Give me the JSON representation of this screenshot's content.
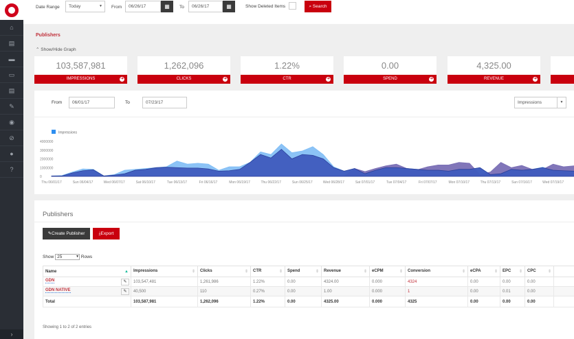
{
  "sidebar": {
    "items": [
      "home-icon",
      "file-icon",
      "folder-icon",
      "card-icon",
      "list-icon",
      "pencil-icon",
      "circle-icon",
      "ban-icon",
      "user-icon",
      "question-icon"
    ],
    "glyphs": [
      "⌂",
      "▤",
      "▬",
      "▭",
      "▤",
      "✎",
      "◉",
      "⊘",
      "●",
      "?"
    ],
    "expand": "›"
  },
  "topbar": {
    "date_range_label": "Date Range",
    "date_range_value": "Today",
    "from_label": "From",
    "from_value": "06/26/17",
    "to_label": "To",
    "to_value": "06/26/17",
    "show_deleted_label": "Show Deleted Items",
    "search_label": "Search"
  },
  "page": {
    "title": "Publishers",
    "toggle_label": "Show/Hide Graph"
  },
  "kpis": [
    {
      "value": "103,587,981",
      "label": "IMPRESSIONS"
    },
    {
      "value": "1,262,096",
      "label": "CLICKS"
    },
    {
      "value": "1.22%",
      "label": "CTR"
    },
    {
      "value": "0.00",
      "label": "SPEND"
    },
    {
      "value": "4,325.00",
      "label": "REVENUE"
    },
    {
      "value": "",
      "label": ""
    }
  ],
  "chart_filter": {
    "from_label": "From",
    "from_value": "06/01/17",
    "to_label": "To",
    "to_value": "07/23/17",
    "metric": "Impressions"
  },
  "chart_data": {
    "type": "area",
    "legend": [
      "Impressions"
    ],
    "legend_position": "top-left",
    "ylim": [
      0,
      4000000
    ],
    "yticks": [
      "0",
      "1000000",
      "2000000",
      "3000000",
      "4000000"
    ],
    "xlabels": [
      "Thu 06/01/17",
      "Sun 06/04/17",
      "Wed 06/07/17",
      "Sat 06/10/17",
      "Tue 06/13/17",
      "Fri 06/16/17",
      "Mon 06/19/17",
      "Thu 06/22/17",
      "Sun 06/25/17",
      "Wed 06/28/17",
      "Sat 07/01/17",
      "Tue 07/04/17",
      "Fri 07/07/17",
      "Mon 07/10/17",
      "Thu 07/13/17",
      "Sun 07/16/17",
      "Wed 07/19/17"
    ],
    "series": [
      {
        "name": "Impressions",
        "color": "#7fbdf5",
        "values": [
          50000,
          100000,
          500000,
          850000,
          800000,
          50000,
          200000,
          700000,
          800000,
          900000,
          1000000,
          1100000,
          1750000,
          1400000,
          1500000,
          1400000,
          700000,
          1100000,
          1100000,
          1600000,
          2800000,
          2500000,
          3700000,
          2700000,
          2900000,
          3400000,
          2500000,
          1100000,
          600000,
          900000,
          400000,
          700000,
          1000000,
          1000000,
          900000,
          800000,
          700000,
          700000,
          600000,
          800000,
          800000,
          1000000,
          200000,
          300000,
          800000,
          700000,
          800000,
          1050000,
          700000,
          650000,
          600000,
          900000,
          1000000
        ]
      },
      {
        "name": "",
        "color": "#7a6fb5",
        "values": [
          0,
          0,
          0,
          0,
          0,
          0,
          0,
          0,
          0,
          0,
          0,
          0,
          0,
          0,
          0,
          0,
          0,
          0,
          0,
          0,
          0,
          0,
          0,
          0,
          0,
          0,
          0,
          0,
          0,
          900000,
          550000,
          900000,
          1200000,
          1400000,
          900000,
          750000,
          1100000,
          1300000,
          1300000,
          1600000,
          1500000,
          200000,
          500000,
          1600000,
          1000000,
          1250000,
          800000,
          800000,
          1400000,
          1100000,
          1200000,
          1300000,
          1200000
        ]
      },
      {
        "name": "",
        "color": "#3f5bbd",
        "values": [
          50000,
          50000,
          400000,
          650000,
          750000,
          50000,
          150000,
          300000,
          700000,
          800000,
          1000000,
          1050000,
          1000000,
          950000,
          950000,
          850000,
          600000,
          650000,
          800000,
          1600000,
          2500000,
          2100000,
          3100000,
          2000000,
          2500000,
          2400000,
          2000000,
          1000000,
          600000,
          900000,
          300000,
          700000,
          1000000,
          1000000,
          900000,
          800000,
          700000,
          700000,
          600000,
          800000,
          800000,
          1000000,
          200000,
          300000,
          800000,
          700000,
          800000,
          1000000,
          700000,
          650000,
          600000,
          900000,
          1000000
        ]
      }
    ]
  },
  "publishers": {
    "title": "Publishers",
    "create_label": "Create Publisher",
    "export_label": "Export",
    "show_label": "Show",
    "page_size": "25",
    "rows_label": "Rows",
    "columns": [
      "Name",
      "Impressions",
      "Clicks",
      "CTR",
      "Spend",
      "Revenue",
      "eCPM",
      "Conversion",
      "eCPA",
      "EPC",
      "CPC",
      ""
    ],
    "rows": [
      [
        "GDN",
        "103,547,481",
        "1,261,986",
        "1.22%",
        "0.00",
        "4324.00",
        "0.000",
        "4324",
        "0.00",
        "0.00",
        "0.00",
        ""
      ],
      [
        "GDN NATIVE",
        "40,500",
        "110",
        "0.27%",
        "0.00",
        "1.00",
        "0.000",
        "1",
        "0.00",
        "0.01",
        "0.00",
        ""
      ]
    ],
    "total": [
      "Total",
      "103,587,981",
      "1,262,096",
      "1.22%",
      "0.00",
      "4325.00",
      "0.000",
      "4325",
      "0.00",
      "0.00",
      "0.00",
      ""
    ],
    "footer": "Showing 1 to 2 of 2 entries"
  }
}
